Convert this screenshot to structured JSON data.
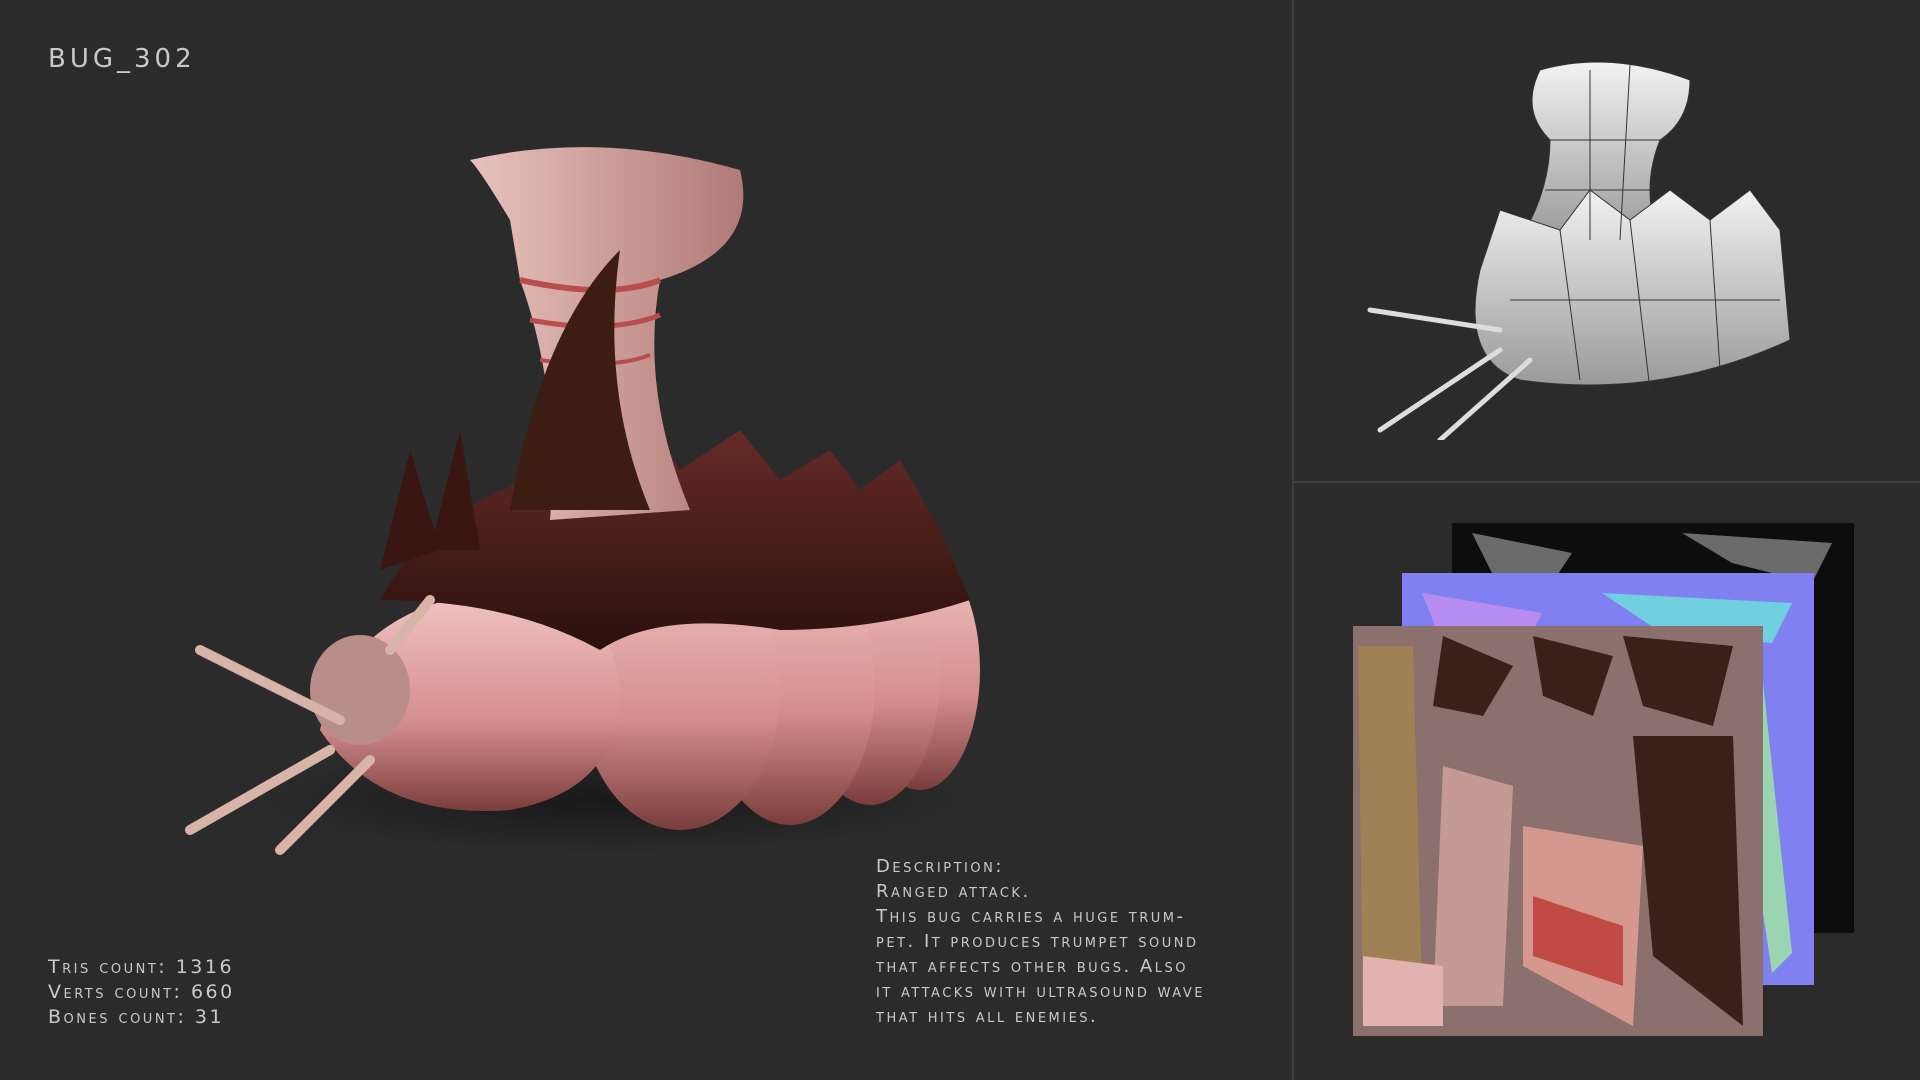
{
  "title": "BUG_302",
  "stats": {
    "tris": "Tris count: 1316",
    "verts": "Verts count: 660",
    "bones": "Bones count: 31"
  },
  "description": {
    "heading": "Description:",
    "lines": [
      "Ranged attack.",
      "This bug carries a huge trum-",
      "pet. It produces trumpet sound",
      "that affects other bugs. Also",
      "it attacks with ultrasound wave",
      "that hits all enemies."
    ]
  },
  "colors": {
    "background": "#2b2b2b",
    "flesh": "#d9a3a3",
    "shell": "#4a1f1c",
    "normal_map": "#8a8cf0",
    "diffuse_map": "#8a6f6d"
  }
}
